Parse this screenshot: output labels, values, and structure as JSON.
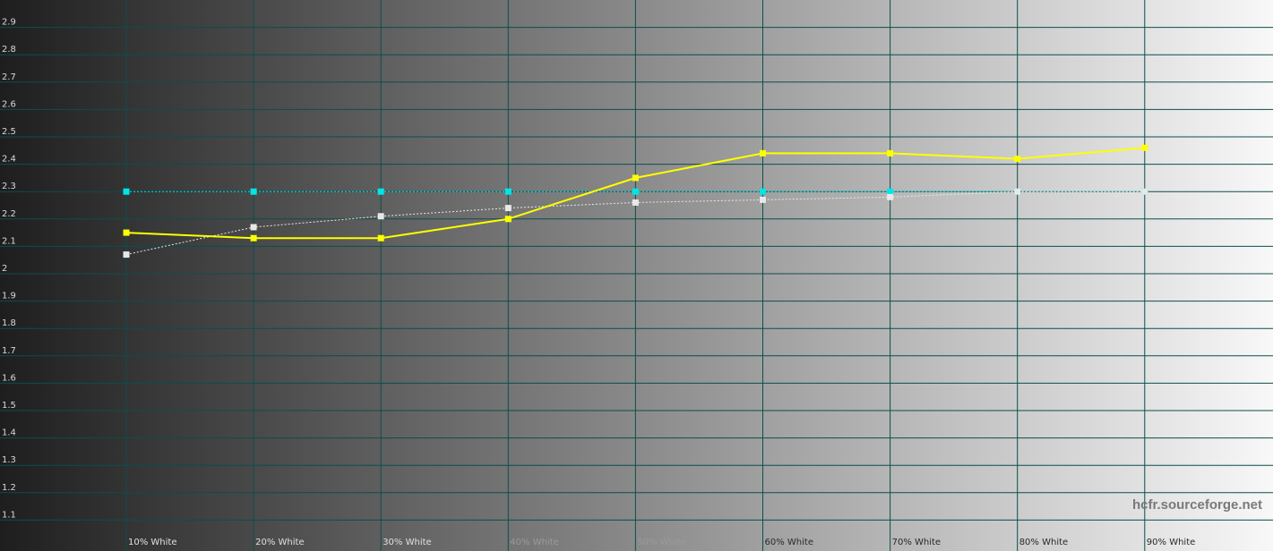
{
  "chart_data": {
    "type": "line",
    "categories": [
      "10% White",
      "20% White",
      "30% White",
      "40% White",
      "50% White",
      "60% White",
      "70% White",
      "80% White",
      "90% White"
    ],
    "ylim": [
      1.0,
      3.0
    ],
    "yticks": [
      "1.1",
      "1.2",
      "1.3",
      "1.4",
      "1.5",
      "1.6",
      "1.7",
      "1.8",
      "1.9",
      "2",
      "2.1",
      "2.2",
      "2.3",
      "2.4",
      "2.5",
      "2.6",
      "2.7",
      "2.8",
      "2.9"
    ],
    "grid": true,
    "background": "grayscale ramp dark to light",
    "series": [
      {
        "values": [
          2.15,
          2.13,
          2.13,
          2.2,
          2.35,
          2.44,
          2.44,
          2.42,
          2.46
        ],
        "color": "#ffff00",
        "style": "solid"
      },
      {
        "values": [
          2.3,
          2.3,
          2.3,
          2.3,
          2.3,
          2.3,
          2.3,
          2.3,
          2.3
        ],
        "color": "#00e6e6",
        "style": "dotted"
      },
      {
        "values": [
          2.07,
          2.17,
          2.21,
          2.24,
          2.26,
          2.27,
          2.28,
          2.3,
          2.3
        ],
        "color": "#e8e8e8",
        "style": "dotted"
      }
    ],
    "watermark": "hcfr.sourceforge.net"
  }
}
